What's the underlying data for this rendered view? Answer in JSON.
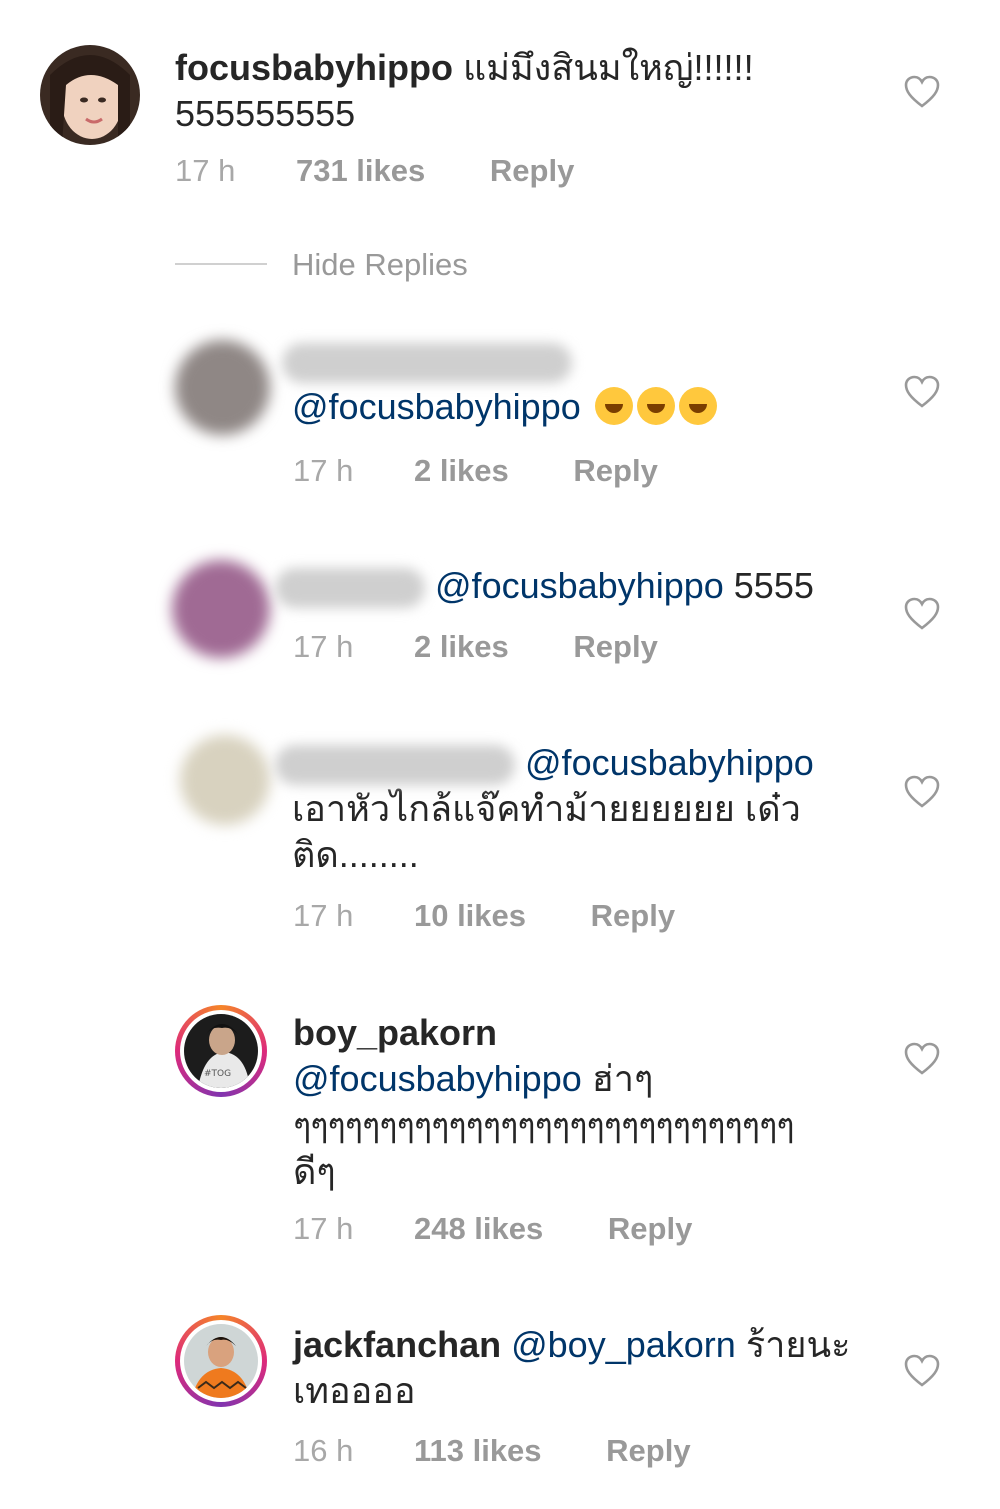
{
  "comments": [
    {
      "username": "focusbabyhippo",
      "text": "แม่มึงสินมใหญ่!!!!!!",
      "text2": "555555555",
      "time": "17 h",
      "likes": "731 likes",
      "reply": "Reply"
    },
    {
      "mention": "@focusbabyhippo",
      "time": "17 h",
      "likes": "2 likes",
      "reply": "Reply"
    },
    {
      "mention": "@focusbabyhippo",
      "text": "5555",
      "time": "17 h",
      "likes": "2 likes",
      "reply": "Reply"
    },
    {
      "mention": "@focusbabyhippo",
      "text": "เอาหัวไกล้แจ๊คทำม้ายยยยยย เด๋ว",
      "text2": "ติด........",
      "time": "17 h",
      "likes": "10 likes",
      "reply": "Reply"
    },
    {
      "username": "boy_pakorn",
      "mention": "@focusbabyhippo",
      "text": "ฮ่าๆ",
      "text2": "ๆๆๆๆๆๆๆๆๆๆๆๆๆๆๆๆๆๆๆๆๆๆๆๆๆๆๆๆๆ",
      "text3": "ดีๆ",
      "time": "17 h",
      "likes": "248 likes",
      "reply": "Reply"
    },
    {
      "username": "jackfanchan",
      "mention": "@boy_pakorn",
      "text": "ร้ายนะ",
      "text2": "เทออออ",
      "time": "16 h",
      "likes": "113 likes",
      "reply": "Reply"
    }
  ],
  "hide_replies": "Hide Replies",
  "icons": {
    "like": "heart-outline-icon"
  },
  "colors": {
    "mention": "#003569",
    "meta": "#999999",
    "text": "#262626"
  }
}
